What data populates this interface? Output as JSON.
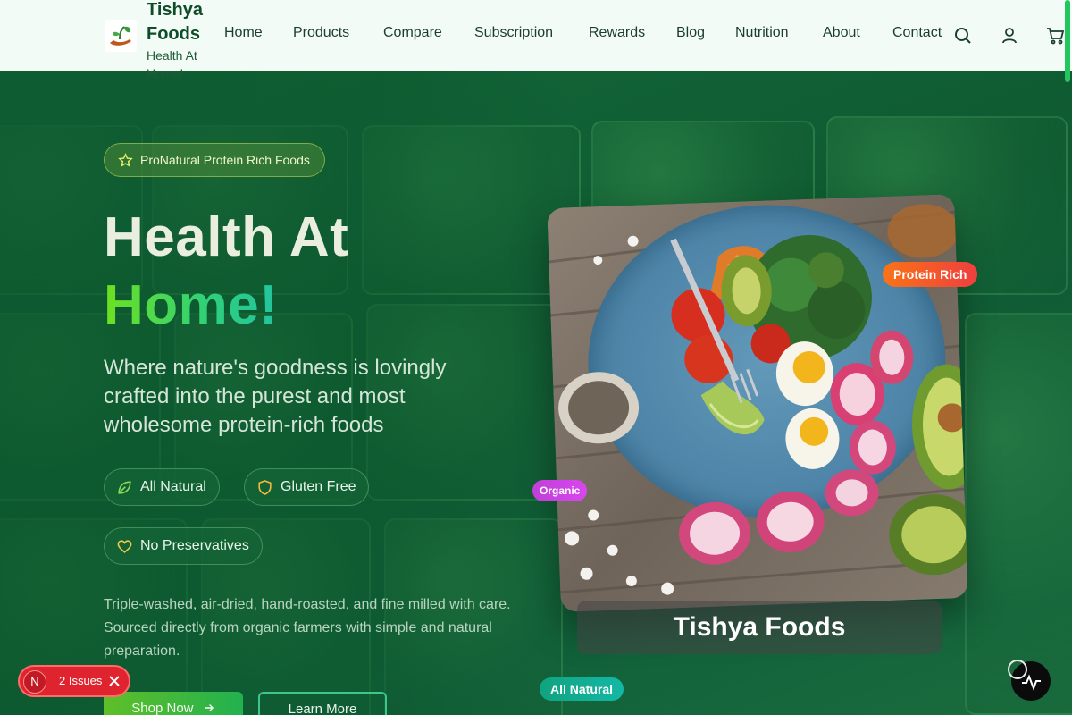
{
  "header": {
    "brand_name": "Tishya Foods",
    "brand_tagline": "Health At Home!",
    "nav": [
      "Home",
      "Products",
      "Compare",
      "Subscription",
      "Rewards",
      "Blog",
      "Nutrition",
      "About",
      "Contact"
    ],
    "icons": [
      "search-icon",
      "user-icon",
      "cart-icon"
    ]
  },
  "hero": {
    "badge": "ProNatural Protein Rich Foods",
    "headline_line1": "Health At",
    "headline_line2": "Home!",
    "subtitle": "Where nature's goodness is lovingly crafted into the purest and most wholesome protein-rich foods",
    "features": [
      {
        "label": "All Natural",
        "icon": "leaf-icon"
      },
      {
        "label": "Gluten Free",
        "icon": "shield-icon"
      },
      {
        "label": "No Preservatives",
        "icon": "heart-icon"
      }
    ],
    "description": "Triple-washed, air-dried, hand-roasted, and fine milled with care. Sourced directly from organic farmers with simple and natural preparation.",
    "cta_primary": "Shop Now",
    "cta_secondary": "Learn More"
  },
  "card": {
    "caption": "Tishya Foods",
    "tag_protein": "Protein Rich",
    "tag_organic": "Organic",
    "tag_natural": "All Natural"
  },
  "devtools": {
    "badge_letter": "N",
    "issues_label": "2 Issues"
  },
  "colors": {
    "header_bg": "#f3fbf6",
    "hero_bg": "#0f5a31",
    "accent_green": "#22c55e",
    "brand_dark": "#0f4d2a"
  }
}
